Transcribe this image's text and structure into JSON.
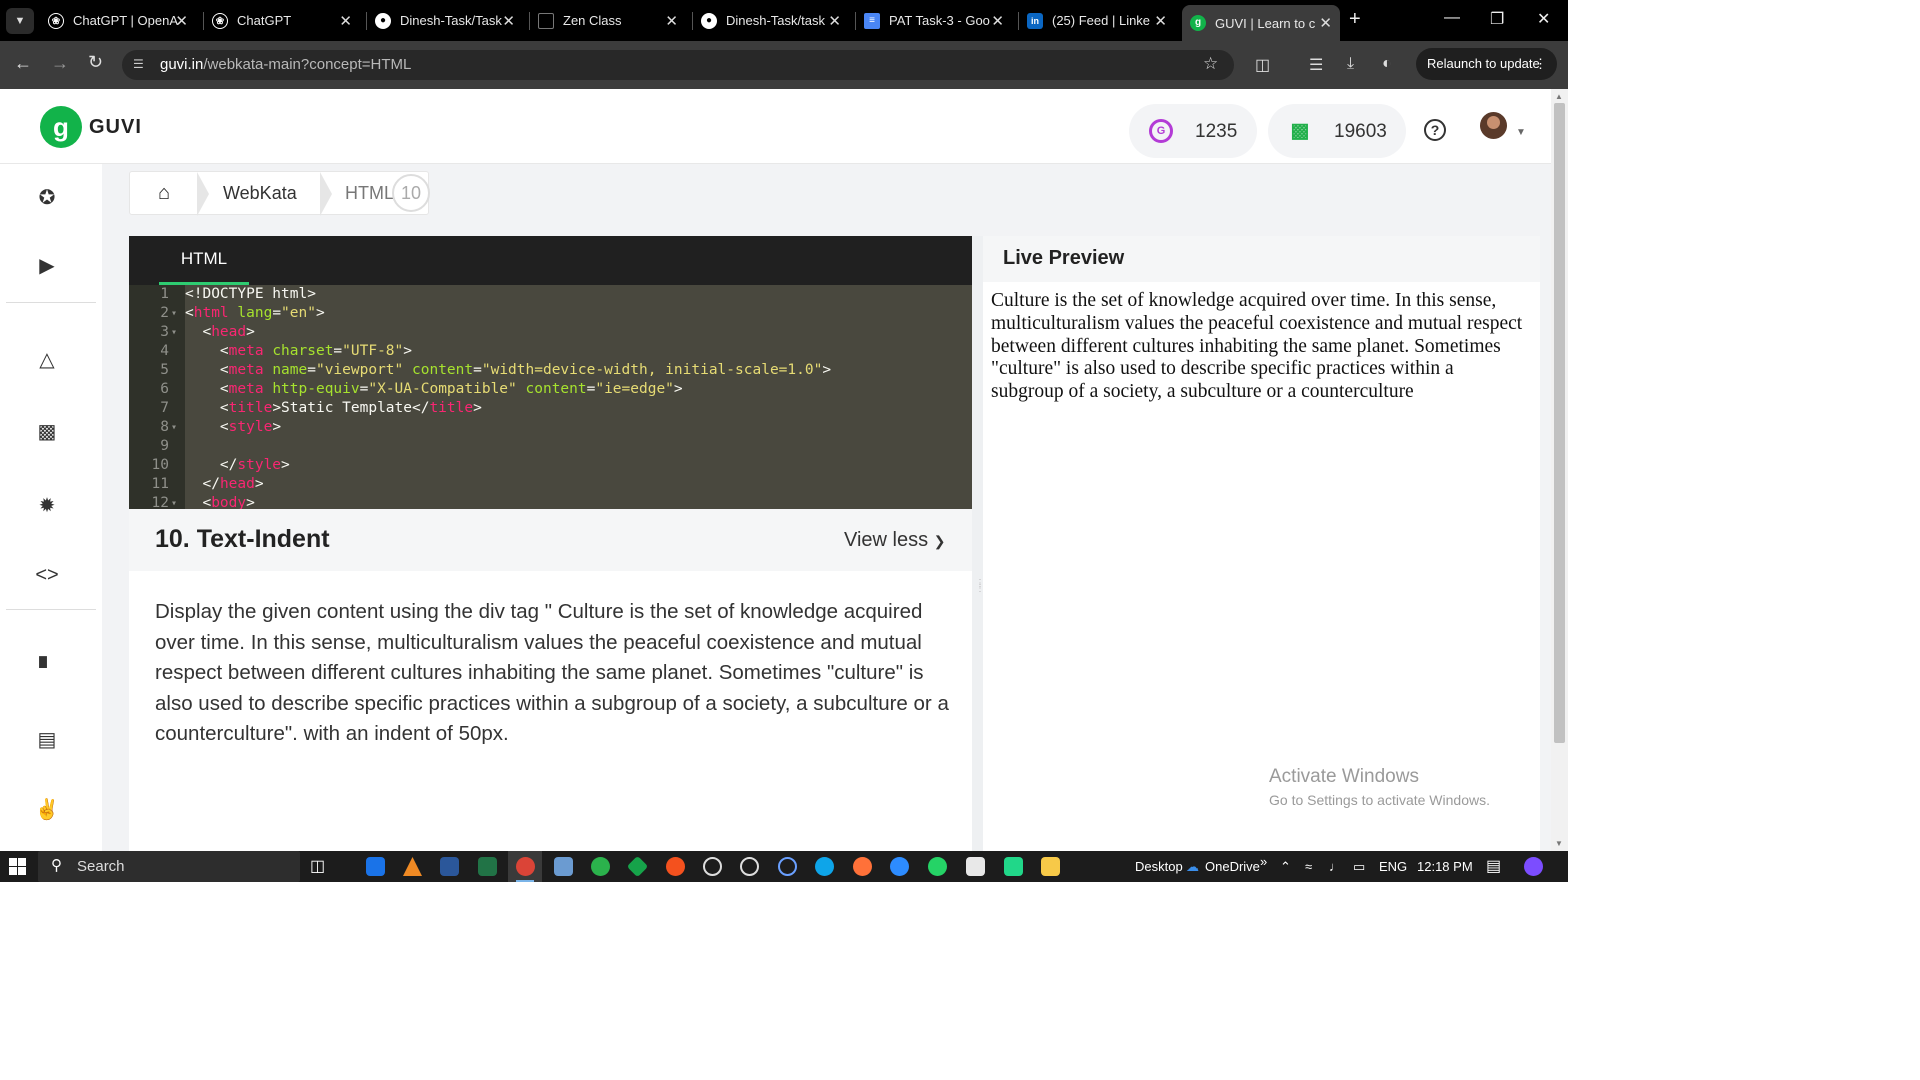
{
  "browser": {
    "tabs": [
      {
        "title": "ChatGPT | OpenA",
        "icon": "openai-icon"
      },
      {
        "title": "ChatGPT",
        "icon": "openai-icon"
      },
      {
        "title": "Dinesh-Task/Task",
        "icon": "github-icon"
      },
      {
        "title": "Zen Class",
        "icon": "zen-class-icon"
      },
      {
        "title": "Dinesh-Task/task",
        "icon": "github-icon"
      },
      {
        "title": "PAT Task-3 - Goo",
        "icon": "google-docs-icon"
      },
      {
        "title": "(25) Feed | Linke",
        "icon": "linkedin-icon"
      },
      {
        "title": "GUVI | Learn to c",
        "icon": "guvi-icon"
      }
    ],
    "url_host": "guvi.in",
    "url_path": "/webkata-main?concept=HTML",
    "relaunch_label": "Relaunch to update"
  },
  "header": {
    "logo_text": "GUVI",
    "logo_letter": "g",
    "gems_icon_letter": "G",
    "gems_count": "1235",
    "rank_count": "19603",
    "help_symbol": "?"
  },
  "breadcrumb": {
    "item1": "WebKata",
    "item2": "HTML",
    "count": "10"
  },
  "editor": {
    "tab_label": "HTML",
    "line_numbers": [
      "1",
      "2",
      "3",
      "4",
      "5",
      "6",
      "7",
      "8",
      "9",
      "10",
      "11",
      "12"
    ]
  },
  "problem": {
    "title": "10. Text-Indent",
    "view_less": "View less",
    "description": "Display the given content using the div tag \" Culture is the set of knowledge acquired over time. In this sense, multiculturalism values the peaceful coexistence and mutual respect between different cultures inhabiting the same planet. Sometimes \"culture\" is also used to describe specific practices within a subgroup of a society, a subculture or a counterculture\". with an indent of 50px."
  },
  "preview": {
    "title": "Live Preview",
    "content": "Culture is the set of knowledge acquired over time. In this sense, multiculturalism values the peaceful coexistence and mutual respect between different cultures inhabiting the same planet. Sometimes \"culture\" is also used to describe specific practices within a subgroup of a society, a subculture or a counterculture"
  },
  "watermark": {
    "line1": "Activate Windows",
    "line2": "Go to Settings to activate Windows."
  },
  "taskbar": {
    "search_label": "Search",
    "desktop_label": "Desktop",
    "onedrive_label": "OneDrive",
    "lang": "ENG",
    "time": "12:18 PM"
  },
  "colors": {
    "guvi_green": "#12b34a",
    "editor_bg": "#272822",
    "tag": "#f92672",
    "attr": "#a6e22e",
    "string": "#e6db74"
  }
}
